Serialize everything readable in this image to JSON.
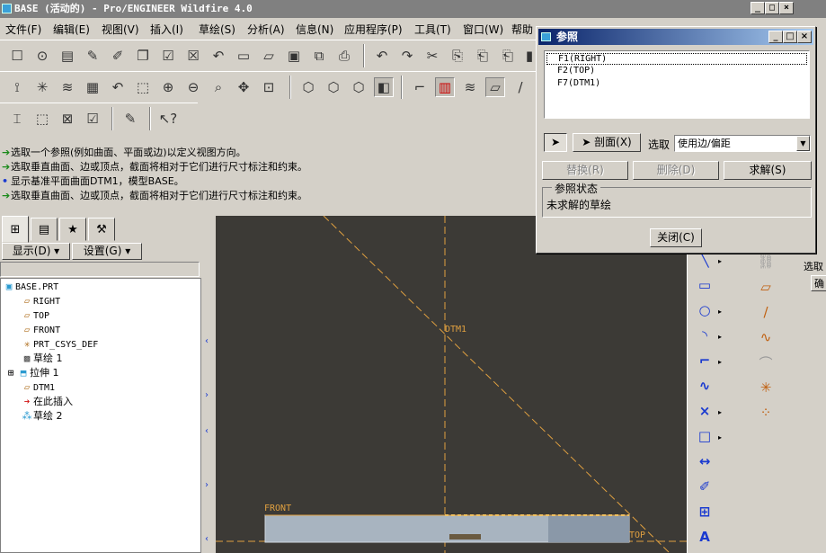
{
  "window": {
    "title": "BASE (活动的) - Pro/ENGINEER Wildfire 4.0",
    "minimize": "_",
    "maximize": "□",
    "close": "×"
  },
  "menu": [
    "文件(F)",
    "编辑(E)",
    "视图(V)",
    "插入(I)",
    "草绘(S)",
    "分析(A)",
    "信息(N)",
    "应用程序(P)",
    "工具(T)",
    "窗口(W)",
    "帮助"
  ],
  "messages": [
    {
      "icon": "green-arrow",
      "text": "选取一个参照(例如曲面、平面或边)以定义视图方向。"
    },
    {
      "icon": "green-arrow",
      "text": "选取垂直曲面、边或顶点，截面将相对于它们进行尺寸标注和约束。"
    },
    {
      "icon": "blue-dot",
      "text": "显示基准平面曲面DTM1，模型BASE。"
    },
    {
      "icon": "green-arrow",
      "text": "选取垂直曲面、边或顶点，截面将相对于它们进行尺寸标注和约束。"
    }
  ],
  "nav": {
    "show_label": "显示(D) ▾",
    "settings_label": "设置(G) ▾"
  },
  "tree": [
    {
      "label": "BASE.PRT",
      "icon": "part-icon"
    },
    {
      "label": "RIGHT",
      "icon": "datum-plane-icon"
    },
    {
      "label": "TOP",
      "icon": "datum-plane-icon"
    },
    {
      "label": "FRONT",
      "icon": "datum-plane-icon"
    },
    {
      "label": "PRT_CSYS_DEF",
      "icon": "csys-icon"
    },
    {
      "label": "草绘 1",
      "icon": "sketch-icon"
    },
    {
      "label": "拉伸 1",
      "icon": "extrude-icon"
    },
    {
      "label": "DTM1",
      "icon": "datum-plane-icon"
    },
    {
      "label": "在此插入",
      "icon": "insert-arrow-icon"
    },
    {
      "label": "草绘 2",
      "icon": "sketch-icon"
    }
  ],
  "canvas": {
    "labels": {
      "dtm1": "DTM1",
      "front": "FRONT",
      "top": "TOP"
    }
  },
  "right_panel": {
    "select_label": "选取",
    "cut_label": "确"
  },
  "dialog": {
    "title": "参照",
    "references": [
      "F1(RIGHT)",
      "F2(TOP)",
      "F7(DTM1)"
    ],
    "section_button": "剖面(X)",
    "select_label": "选取",
    "select_value": "使用边/偏距",
    "replace_button": "替换(R)",
    "delete_button": "删除(D)",
    "solve_button": "求解(S)",
    "status_legend": "参照状态",
    "status_value": "未求解的草绘",
    "close_button": "关闭(C)"
  },
  "colors": {
    "canvas_bg": "#3c3a36",
    "dialog_title_start": "#0a246a",
    "datum": "#e0a040"
  }
}
